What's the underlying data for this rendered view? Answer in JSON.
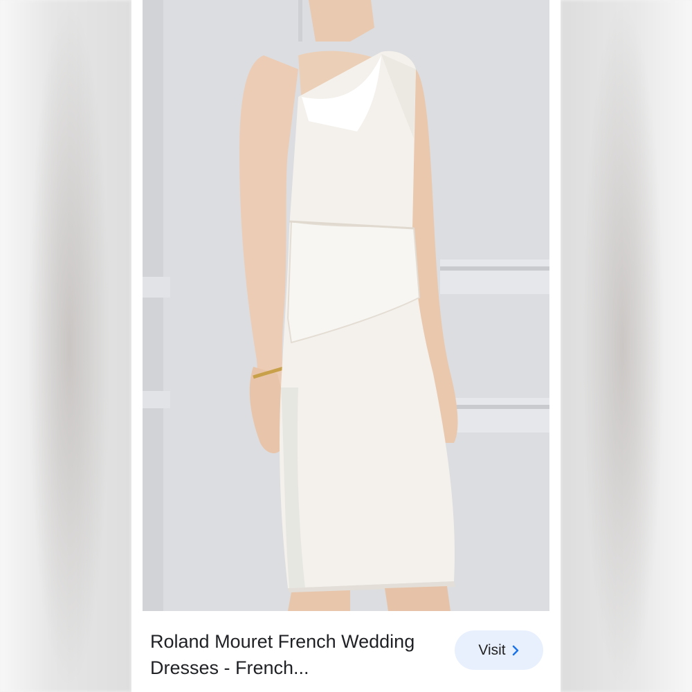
{
  "result": {
    "title": "Roland Mouret French Wedding Dresses - French...",
    "visit_label": "Visit"
  },
  "icons": {
    "visit_chevron": "chevron-right-icon"
  },
  "colors": {
    "visit_button_bg": "#e8f0fe",
    "title_text": "#202124",
    "dress": "#f4f1ec",
    "wall": "#d9dadc"
  }
}
